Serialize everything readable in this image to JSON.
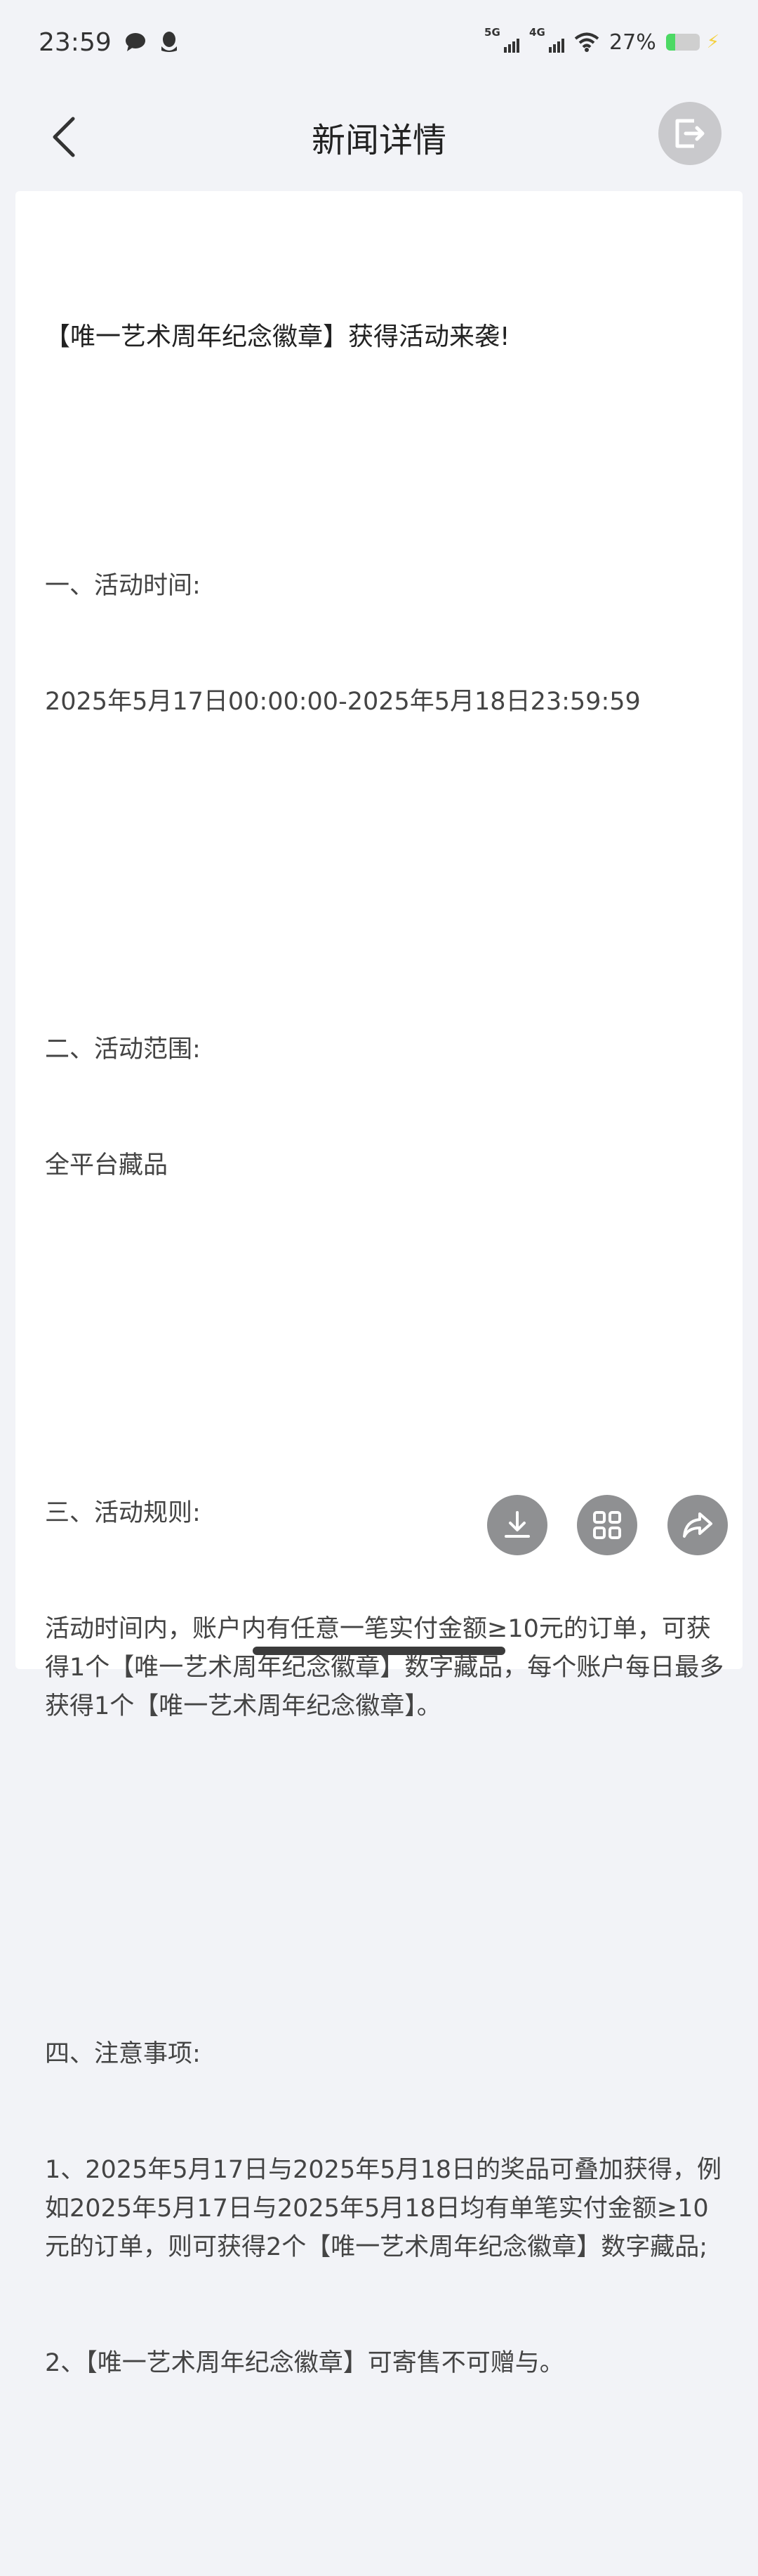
{
  "status": {
    "time": "23:59",
    "signal1": "5G",
    "signal2": "4G",
    "battery_text": "27%",
    "battery_level": 0.27
  },
  "header": {
    "title": "新闻详情"
  },
  "article": {
    "headline": "【唯一艺术周年纪念徽章】获得活动来袭!",
    "sections": [
      {
        "heading": "一、活动时间:",
        "body": [
          "2025年5月17日00:00:00-2025年5月18日23:59:59"
        ]
      },
      {
        "heading": "二、活动范围:",
        "body": [
          "全平台藏品"
        ]
      },
      {
        "heading": "三、活动规则:",
        "body": [
          "活动时间内，账户内有任意一笔实付金额≥10元的订单，可获得1个【唯一艺术周年纪念徽章】数字藏品，每个账户每日最多获得1个【唯一艺术周年纪念徽章】。"
        ]
      },
      {
        "heading": "四、注意事项:",
        "body": [
          "1、2025年5月17日与2025年5月18日的奖品可叠加获得，例如2025年5月17日与2025年5月18日均有单笔实付金额≥10元的订单，则可获得2个【唯一艺术周年纪念徽章】数字藏品;",
          "2、【唯一艺术周年纪念徽章】可寄售不可赠与。"
        ]
      }
    ]
  },
  "colors": {
    "background": "#f2f3f7",
    "card": "#ffffff",
    "fab": "#8f9092"
  },
  "icons": [
    "back-arrow-icon",
    "exit-share-icon",
    "download-icon",
    "grid-icon",
    "share-icon",
    "message-icon",
    "qq-icon",
    "wifi-icon"
  ]
}
